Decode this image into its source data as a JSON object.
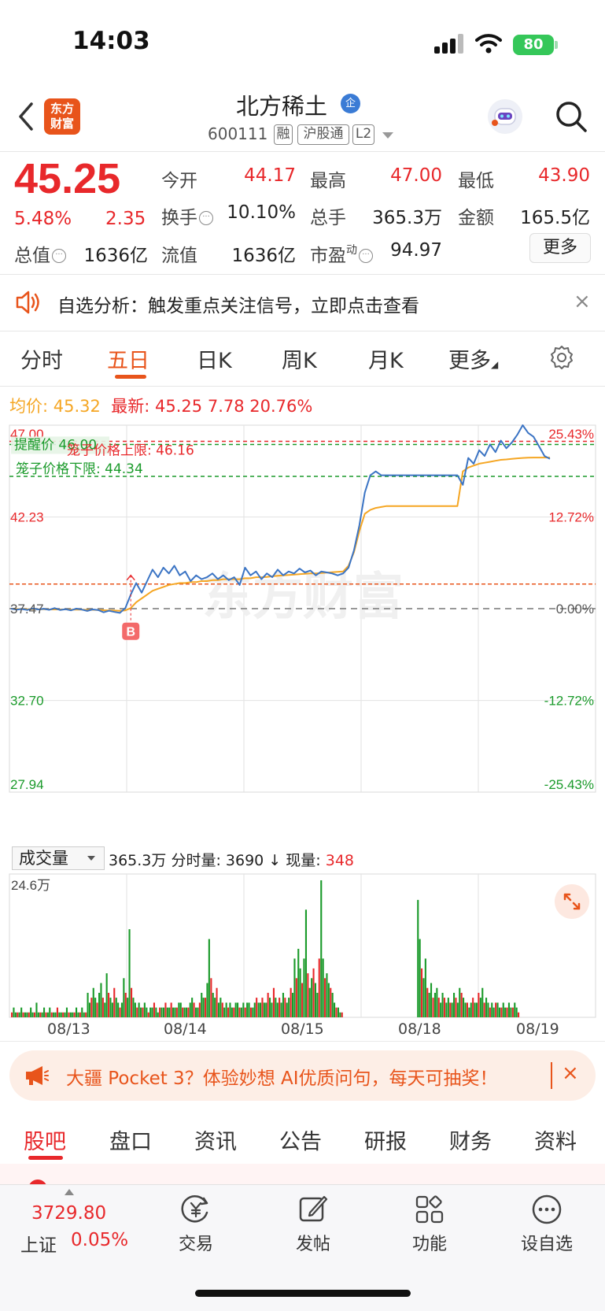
{
  "status_bar": {
    "time": "14:03",
    "battery": "80"
  },
  "header": {
    "logo_line1": "东方",
    "logo_line2": "财富",
    "stock_name": "北方稀土",
    "name_badge": "企",
    "stock_code": "600111",
    "tags": [
      "融",
      "沪股通",
      "L2"
    ]
  },
  "quote": {
    "price": "45.25",
    "change_pct": "5.48%",
    "change_amt": "2.35",
    "fields": [
      {
        "label": "今开",
        "value": "44.17",
        "color": "red"
      },
      {
        "label": "最高",
        "value": "47.00",
        "color": "red"
      },
      {
        "label": "最低",
        "value": "43.90",
        "color": "red"
      },
      {
        "label": "换手",
        "value": "10.10%",
        "color": "black"
      },
      {
        "label": "总手",
        "value": "365.3万",
        "color": "black"
      },
      {
        "label": "金额",
        "value": "165.5亿",
        "color": "black"
      },
      {
        "label": "总值",
        "value": "1636亿",
        "color": "black"
      },
      {
        "label": "流值",
        "value": "1636亿",
        "color": "black"
      },
      {
        "label": "市盈",
        "value": "94.97",
        "color": "black"
      }
    ],
    "pe_superscript": "动",
    "more_label": "更多"
  },
  "alert": {
    "text": "自选分析：触发重点关注信号，立即点击查看",
    "close": "×"
  },
  "tabs": {
    "items": [
      "分时",
      "五日",
      "日K",
      "周K",
      "月K",
      "更多"
    ],
    "active": "五日"
  },
  "summary": {
    "avg_label": "均价:",
    "avg_value": "45.32",
    "latest_label": "最新:",
    "latest_value": "45.25",
    "latest_change": "7.78",
    "latest_pct": "20.76%"
  },
  "chart_data": {
    "type": "line",
    "days": [
      "08/13",
      "08/14",
      "08/15",
      "08/18",
      "08/19"
    ],
    "y_ticks": [
      "47.00",
      "42.23",
      "37.47",
      "32.70",
      "27.94"
    ],
    "y_ticks_pct": [
      "25.43%",
      "12.72%",
      "0.00%",
      "-12.72%",
      "-25.43%"
    ],
    "ylim": [
      27.94,
      47.0
    ],
    "reference_price": 37.47,
    "alert_price_label": "提醒价",
    "alert_price": "46.00",
    "cage_upper_label": "笼子价格上限:",
    "cage_upper": "46.16",
    "cage_lower_label": "笼子价格下限:",
    "cage_lower": "44.34",
    "buy_marker": "B",
    "buy_marker_price": 39.2,
    "series": [
      {
        "name": "最新",
        "color": "#3b74c4",
        "values": [
          37.47,
          37.42,
          37.45,
          37.4,
          37.48,
          37.43,
          37.46,
          37.41,
          37.5,
          37.4,
          37.44,
          37.38,
          37.47,
          37.42,
          37.35,
          37.43,
          37.4,
          37.28,
          37.36,
          37.3,
          37.25,
          37.5,
          38.2,
          38.8,
          38.3,
          38.9,
          39.5,
          39.1,
          39.6,
          39.3,
          39.7,
          39.2,
          39.4,
          38.9,
          39.2,
          39.0,
          39.1,
          39.3,
          39.0,
          39.2,
          38.95,
          39.1,
          38.7,
          39.6,
          39.2,
          39.4,
          39.0,
          39.3,
          39.1,
          39.5,
          39.2,
          39.4,
          39.3,
          39.55,
          39.35,
          39.45,
          39.2,
          39.4,
          39.35,
          39.3,
          39.2,
          39.3,
          39.6,
          40.5,
          41.8,
          43.5,
          44.4,
          44.6,
          44.4,
          44.4,
          44.4,
          44.4,
          44.4,
          44.4,
          44.4,
          44.4,
          44.4,
          44.4,
          44.4,
          44.4,
          44.4,
          44.4,
          44.4,
          43.9,
          45.3,
          45.0,
          45.7,
          45.4,
          46.0,
          45.6,
          46.2,
          45.8,
          46.1,
          46.5,
          47.0,
          46.6,
          46.4,
          45.9,
          45.4,
          45.25
        ]
      },
      {
        "name": "均价",
        "color": "#f5a623",
        "values": [
          37.47,
          37.45,
          37.45,
          37.44,
          37.44,
          37.44,
          37.44,
          37.43,
          37.43,
          37.43,
          37.43,
          37.42,
          37.42,
          37.42,
          37.41,
          37.41,
          37.4,
          37.39,
          37.38,
          37.37,
          37.36,
          37.38,
          37.5,
          37.8,
          38.0,
          38.2,
          38.4,
          38.5,
          38.6,
          38.7,
          38.75,
          38.8,
          38.8,
          38.85,
          38.85,
          38.9,
          38.9,
          38.95,
          38.95,
          39.0,
          39.0,
          39.0,
          39.0,
          39.05,
          39.05,
          39.1,
          39.1,
          39.12,
          39.15,
          39.18,
          39.2,
          39.22,
          39.24,
          39.26,
          39.28,
          39.3,
          39.3,
          39.32,
          39.34,
          39.36,
          39.38,
          39.4,
          39.7,
          40.4,
          41.5,
          42.4,
          42.6,
          42.7,
          42.75,
          42.8,
          42.8,
          42.8,
          42.8,
          42.8,
          42.8,
          42.8,
          42.8,
          42.8,
          42.8,
          42.8,
          42.8,
          42.8,
          42.8,
          44.6,
          44.8,
          44.9,
          45.0,
          45.05,
          45.1,
          45.15,
          45.2,
          45.22,
          45.25,
          45.28,
          45.3,
          45.31,
          45.32,
          45.32,
          45.32,
          45.32
        ]
      }
    ]
  },
  "volume": {
    "selector_label": "成交量",
    "total": "365.3万",
    "period_label": "分时量:",
    "period_value": "3690",
    "current_label": "现量:",
    "current_value": "348",
    "max_label": "24.6万",
    "values": [
      1,
      2,
      1,
      1,
      1,
      2,
      1,
      1,
      1,
      1,
      2,
      1,
      1,
      3,
      1,
      1,
      1,
      2,
      1,
      1,
      2,
      1,
      1,
      1,
      2,
      1,
      1,
      1,
      1,
      2,
      1,
      1,
      1,
      1,
      2,
      1,
      1,
      2,
      1,
      1,
      5,
      3,
      4,
      6,
      4,
      3,
      5,
      7,
      4,
      3,
      9,
      5,
      4,
      3,
      6,
      4,
      3,
      2,
      3,
      8,
      5,
      4,
      18,
      6,
      4,
      3,
      2,
      3,
      2,
      2,
      3,
      2,
      1,
      2,
      2,
      3,
      2,
      1,
      2,
      2,
      2,
      3,
      2,
      2,
      3,
      2,
      2,
      2,
      3,
      3,
      2,
      2,
      2,
      2,
      3,
      4,
      3,
      2,
      2,
      3,
      5,
      4,
      4,
      7,
      16,
      8,
      5,
      4,
      6,
      3,
      4,
      3,
      2,
      3,
      2,
      3,
      2,
      2,
      3,
      3,
      2,
      2,
      3,
      2,
      3,
      3,
      2,
      2,
      3,
      4,
      3,
      3,
      4,
      3,
      3,
      5,
      4,
      3,
      6,
      4,
      3,
      4,
      3,
      5,
      4,
      3,
      4,
      6,
      5,
      12,
      8,
      14,
      10,
      7,
      12,
      22,
      9,
      6,
      8,
      10,
      7,
      5,
      12,
      28,
      12,
      8,
      9,
      7,
      6,
      5,
      3,
      2,
      2,
      1,
      1,
      0,
      0,
      0,
      0,
      0,
      0,
      0,
      0,
      0,
      0,
      0,
      0,
      0,
      0,
      0,
      0,
      0,
      0,
      0,
      0,
      0,
      0,
      0,
      0,
      0,
      0,
      0,
      0,
      0,
      0,
      0,
      0,
      0,
      0,
      0,
      0,
      0,
      0,
      0,
      24,
      16,
      10,
      8,
      12,
      6,
      5,
      7,
      4,
      5,
      6,
      4,
      3,
      5,
      4,
      3,
      4,
      3,
      3,
      5,
      4,
      3,
      6,
      5,
      4,
      3,
      3,
      2,
      3,
      4,
      3,
      3,
      5,
      4,
      6,
      3,
      4,
      3,
      2,
      3,
      2,
      3,
      3,
      2,
      2,
      3,
      2,
      2,
      3,
      2,
      2,
      3,
      2,
      1,
      0,
      0,
      0,
      0,
      0,
      0,
      0,
      0,
      0,
      0,
      0,
      0,
      0,
      0,
      0,
      0
    ]
  },
  "ad": {
    "text": "大疆 Pocket 3？体验妙想 AI优质问句，每天可抽奖！",
    "close": "×"
  },
  "bottom_tabs": {
    "items": [
      "股吧",
      "盘口",
      "资讯",
      "公告",
      "研报",
      "财务",
      "资料"
    ],
    "active": "股吧"
  },
  "bottom_nav": {
    "index_value": "3729.80",
    "index_name": "上证",
    "index_pct": "0.05%",
    "items": [
      "交易",
      "发帖",
      "功能",
      "设自选"
    ]
  }
}
